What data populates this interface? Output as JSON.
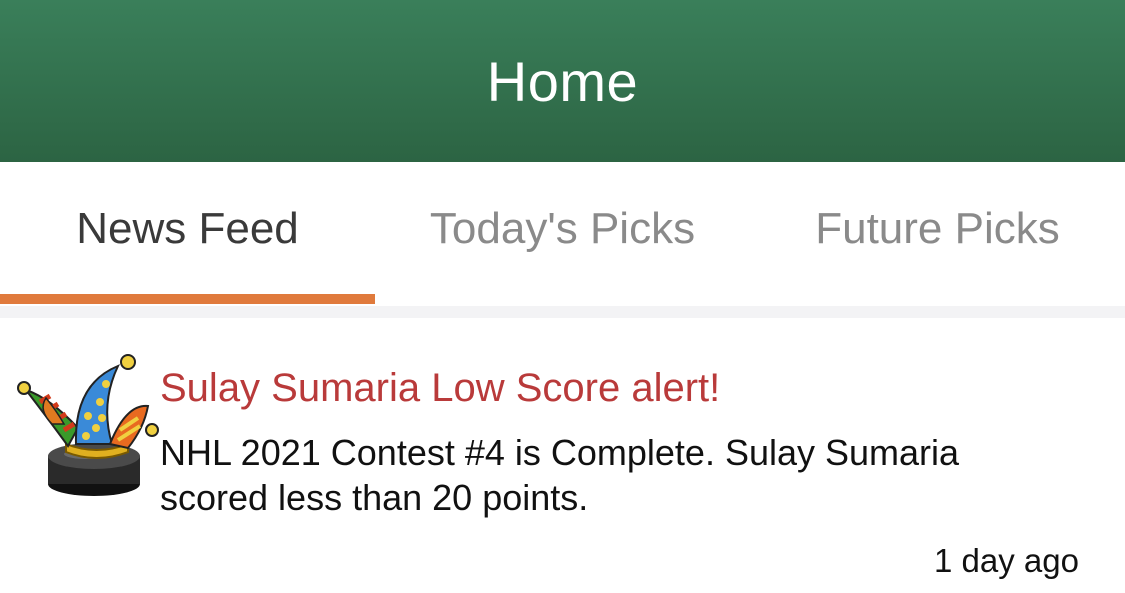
{
  "header": {
    "title": "Home"
  },
  "tabs": [
    {
      "label": "News Feed",
      "active": true
    },
    {
      "label": "Today's Picks",
      "active": false
    },
    {
      "label": "Future Picks",
      "active": false
    }
  ],
  "colors": {
    "header_green": "#2f6b48",
    "tab_indicator": "#e07a3c",
    "alert_title": "#b93a3a"
  },
  "feed": [
    {
      "avatar_icon": "jester-hat-hockey-puck-icon",
      "title": "Sulay Sumaria Low Score alert!",
      "body": "NHL 2021 Contest #4 is Complete. Sulay Sumaria scored less than 20 points.",
      "time": "1 day ago"
    }
  ]
}
